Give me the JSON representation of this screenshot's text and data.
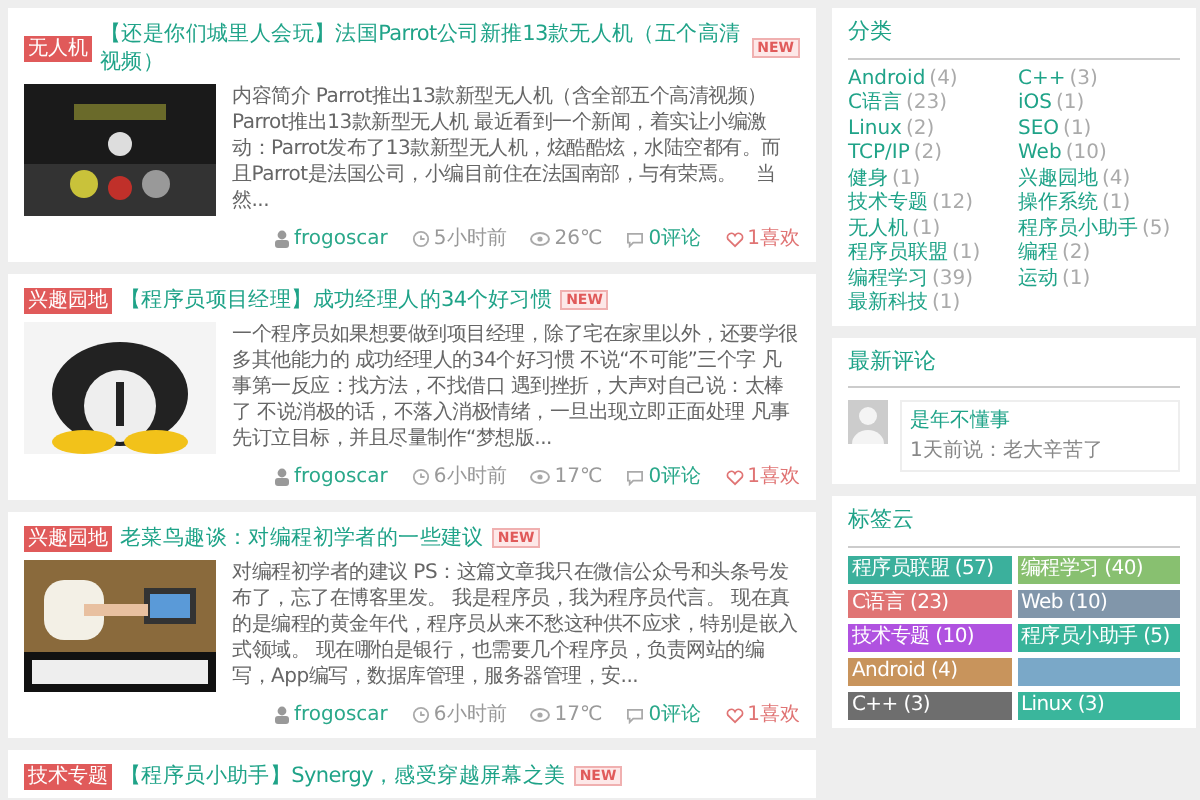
{
  "posts": [
    {
      "tag": "无人机",
      "title": "【还是你们城里人会玩】法国Parrot公司新推13款无人机（五个高清视频）",
      "badge": "NEW",
      "excerpt": "内容简介 Parrot推出13款新型无人机（含全部五个高清视频） Parrot推出13款新型无人机 最近看到一个新闻，着实让小编激动：Parrot发布了13款新型无人机，炫酷酷炫，水陆空都有。而且Parrot是法国公司，小编目前住在法国南部，与有荣焉。　当然...",
      "author": "frogoscar",
      "time": "5小时前",
      "views": "26℃",
      "comments": "0评论",
      "likes": "1喜欢"
    },
    {
      "tag": "兴趣园地",
      "title": "【程序员项目经理】成功经理人的34个好习惯",
      "badge": "NEW",
      "excerpt": "一个程序员如果想要做到项目经理，除了宅在家里以外，还要学很多其他能力的 成功经理人的34个好习惯 不说“不可能”三个字 凡事第一反应：找方法，不找借口 遇到挫折，大声对自己说：太棒了 不说消极的话，不落入消极情绪，一旦出现立即正面处理 凡事先订立目标，并且尽量制作“梦想版...",
      "author": "frogoscar",
      "time": "6小时前",
      "views": "17℃",
      "comments": "0评论",
      "likes": "1喜欢"
    },
    {
      "tag": "兴趣园地",
      "title": "老菜鸟趣谈：对编程初学者的一些建议",
      "badge": "NEW",
      "excerpt": "对编程初学者的建议 PS：这篇文章我只在微信公众号和头条号发布了，忘了在博客里发。 我是程序员，我为程序员代言。 现在真的是编程的黄金年代，程序员从来不愁这种供不应求，特别是嵌入式领域。 现在哪怕是银行，也需要几个程序员，负责网站的编写，App编写，数据库管理，服务器管理，安...",
      "author": "frogoscar",
      "time": "6小时前",
      "views": "17℃",
      "comments": "0评论",
      "likes": "1喜欢"
    },
    {
      "tag": "技术专题",
      "title": "【程序员小助手】Synergy，感受穿越屏幕之美",
      "badge": "NEW"
    }
  ],
  "categories": {
    "title": "分类",
    "items": [
      {
        "name": "Android",
        "count": "(4)"
      },
      {
        "name": "C++",
        "count": "(3)"
      },
      {
        "name": "C语言",
        "count": "(23)"
      },
      {
        "name": "iOS",
        "count": "(1)"
      },
      {
        "name": "Linux",
        "count": "(2)"
      },
      {
        "name": "SEO",
        "count": "(1)"
      },
      {
        "name": "TCP/IP",
        "count": "(2)"
      },
      {
        "name": "Web",
        "count": "(10)"
      },
      {
        "name": "健身",
        "count": "(1)"
      },
      {
        "name": "兴趣园地",
        "count": "(4)"
      },
      {
        "name": "技术专题",
        "count": "(12)"
      },
      {
        "name": "操作系统",
        "count": "(1)"
      },
      {
        "name": "无人机",
        "count": "(1)"
      },
      {
        "name": "程序员小助手",
        "count": "(5)"
      },
      {
        "name": "程序员联盟",
        "count": "(1)"
      },
      {
        "name": "编程",
        "count": "(2)"
      },
      {
        "name": "编程学习",
        "count": "(39)"
      },
      {
        "name": "运动",
        "count": "(1)"
      },
      {
        "name": "最新科技",
        "count": "(1)"
      }
    ]
  },
  "comments": {
    "title": "最新评论",
    "items": [
      {
        "author": "是年不懂事",
        "text": "1天前说：老大辛苦了"
      }
    ]
  },
  "tag_cloud": {
    "title": "标签云",
    "tags": [
      {
        "label": "程序员联盟 (57)",
        "color": "#3bb09c"
      },
      {
        "label": "编程学习 (40)",
        "color": "#88c070"
      },
      {
        "label": "C语言 (23)",
        "color": "#e07474"
      },
      {
        "label": "Web (10)",
        "color": "#8196aa"
      },
      {
        "label": "技术专题 (10)",
        "color": "#b052e0"
      },
      {
        "label": "程序员小助手 (5)",
        "color": "#38b49a"
      },
      {
        "label": "Android (4)",
        "color": "#c8945c"
      },
      {
        "color": "#7aa8c8"
      },
      {
        "label": "C++ (3)",
        "color": "#6e6e6e"
      },
      {
        "label": "Linux (3)",
        "color": "#3ab69c"
      }
    ]
  }
}
